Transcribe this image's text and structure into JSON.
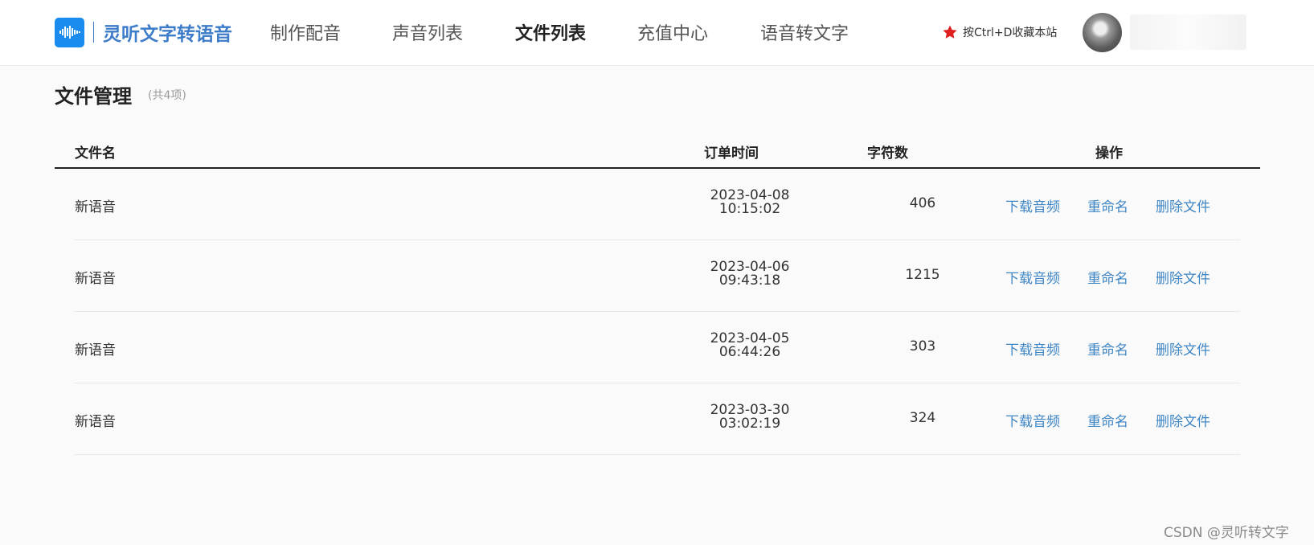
{
  "header": {
    "logo_text": "灵听文字转语音",
    "nav": [
      {
        "label": "制作配音",
        "active": false
      },
      {
        "label": "声音列表",
        "active": false
      },
      {
        "label": "文件列表",
        "active": true
      },
      {
        "label": "充值中心",
        "active": false
      },
      {
        "label": "语音转文字",
        "active": false
      }
    ],
    "bookmark_text": "按Ctrl+D收藏本站",
    "bookmark_icon": "star-icon",
    "accent_color": "#e02020"
  },
  "page": {
    "title": "文件管理",
    "count": "(共4项)"
  },
  "table": {
    "columns": {
      "name": "文件名",
      "time": "订单时间",
      "chars": "字符数",
      "actions": "操作"
    },
    "rows": [
      {
        "name": "新语音",
        "date": "2023-04-08",
        "time": "10:15:02",
        "chars": "406"
      },
      {
        "name": "新语音",
        "date": "2023-04-06",
        "time": "09:43:18",
        "chars": "1215"
      },
      {
        "name": "新语音",
        "date": "2023-04-05",
        "time": "06:44:26",
        "chars": "303"
      },
      {
        "name": "新语音",
        "date": "2023-03-30",
        "time": "03:02:19",
        "chars": "324"
      }
    ],
    "action_labels": {
      "download": "下载音频",
      "rename": "重命名",
      "delete": "删除文件"
    },
    "link_color": "#3f86c4"
  },
  "watermark": "CSDN @灵听转文字"
}
